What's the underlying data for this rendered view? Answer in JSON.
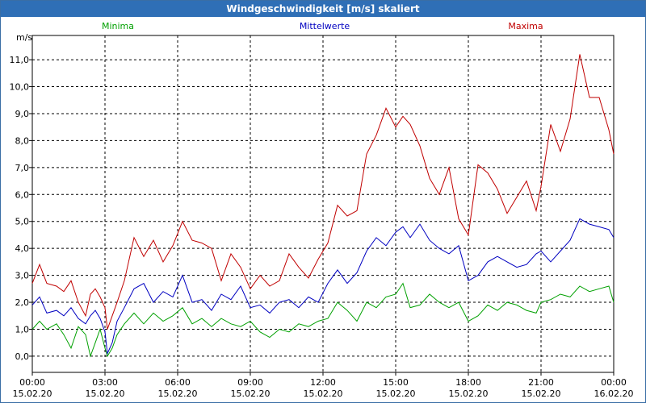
{
  "chart_data": {
    "type": "line",
    "title": "Windgeschwindigkeit [m/s] skaliert",
    "ylabel": "m/s",
    "xlabel": "",
    "ylim": [
      -0.6,
      11.9
    ],
    "xlim": [
      0,
      24
    ],
    "grid": true,
    "legend": "top",
    "y_ticks": [
      "0,0",
      "1,0",
      "2,0",
      "3,0",
      "4,0",
      "5,0",
      "6,0",
      "7,0",
      "8,0",
      "9,0",
      "10,0",
      "11,0"
    ],
    "x_ticks": [
      {
        "time": "00:00",
        "date": "15.02.20"
      },
      {
        "time": "03:00",
        "date": "15.02.20"
      },
      {
        "time": "06:00",
        "date": "15.02.20"
      },
      {
        "time": "09:00",
        "date": "15.02.20"
      },
      {
        "time": "12:00",
        "date": "15.02.20"
      },
      {
        "time": "15:00",
        "date": "15.02.20"
      },
      {
        "time": "18:00",
        "date": "15.02.20"
      },
      {
        "time": "21:00",
        "date": "15.02.20"
      },
      {
        "time": "00:00",
        "date": "16.02.20"
      }
    ],
    "series": [
      {
        "name": "Minima",
        "color": "#00a000",
        "points": [
          [
            0,
            1.0
          ],
          [
            0.3,
            1.3
          ],
          [
            0.6,
            1.0
          ],
          [
            1.0,
            1.2
          ],
          [
            1.3,
            0.8
          ],
          [
            1.6,
            0.3
          ],
          [
            1.9,
            1.1
          ],
          [
            2.2,
            0.8
          ],
          [
            2.4,
            0.0
          ],
          [
            2.6,
            0.5
          ],
          [
            2.8,
            1.0
          ],
          [
            3.0,
            0.3
          ],
          [
            3.1,
            0.0
          ],
          [
            3.3,
            0.3
          ],
          [
            3.5,
            0.8
          ],
          [
            3.8,
            1.2
          ],
          [
            4.2,
            1.6
          ],
          [
            4.6,
            1.2
          ],
          [
            5.0,
            1.6
          ],
          [
            5.4,
            1.3
          ],
          [
            5.8,
            1.5
          ],
          [
            6.2,
            1.8
          ],
          [
            6.6,
            1.2
          ],
          [
            7.0,
            1.4
          ],
          [
            7.4,
            1.1
          ],
          [
            7.8,
            1.4
          ],
          [
            8.2,
            1.2
          ],
          [
            8.6,
            1.1
          ],
          [
            9.0,
            1.3
          ],
          [
            9.4,
            0.9
          ],
          [
            9.8,
            0.7
          ],
          [
            10.2,
            1.0
          ],
          [
            10.6,
            0.9
          ],
          [
            11.0,
            1.2
          ],
          [
            11.4,
            1.1
          ],
          [
            11.8,
            1.3
          ],
          [
            12.2,
            1.4
          ],
          [
            12.6,
            2.0
          ],
          [
            13.0,
            1.7
          ],
          [
            13.4,
            1.3
          ],
          [
            13.8,
            2.0
          ],
          [
            14.2,
            1.8
          ],
          [
            14.6,
            2.2
          ],
          [
            15.0,
            2.3
          ],
          [
            15.3,
            2.7
          ],
          [
            15.6,
            1.8
          ],
          [
            16.0,
            1.9
          ],
          [
            16.4,
            2.3
          ],
          [
            16.8,
            2.0
          ],
          [
            17.2,
            1.8
          ],
          [
            17.6,
            2.0
          ],
          [
            18.0,
            1.3
          ],
          [
            18.4,
            1.5
          ],
          [
            18.8,
            1.9
          ],
          [
            19.2,
            1.7
          ],
          [
            19.6,
            2.0
          ],
          [
            20.0,
            1.9
          ],
          [
            20.4,
            1.7
          ],
          [
            20.8,
            1.6
          ],
          [
            21.0,
            2.0
          ],
          [
            21.4,
            2.1
          ],
          [
            21.8,
            2.3
          ],
          [
            22.2,
            2.2
          ],
          [
            22.6,
            2.6
          ],
          [
            23.0,
            2.4
          ],
          [
            23.4,
            2.5
          ],
          [
            23.8,
            2.6
          ],
          [
            24.0,
            2.0
          ]
        ]
      },
      {
        "name": "Mittelwerte",
        "color": "#0000c0",
        "points": [
          [
            0,
            1.9
          ],
          [
            0.3,
            2.2
          ],
          [
            0.6,
            1.6
          ],
          [
            1.0,
            1.7
          ],
          [
            1.3,
            1.5
          ],
          [
            1.6,
            1.8
          ],
          [
            1.9,
            1.4
          ],
          [
            2.2,
            1.2
          ],
          [
            2.4,
            1.5
          ],
          [
            2.6,
            1.7
          ],
          [
            2.8,
            1.4
          ],
          [
            3.0,
            0.9
          ],
          [
            3.1,
            0.1
          ],
          [
            3.3,
            0.5
          ],
          [
            3.5,
            1.3
          ],
          [
            3.8,
            1.8
          ],
          [
            4.2,
            2.5
          ],
          [
            4.6,
            2.7
          ],
          [
            5.0,
            2.0
          ],
          [
            5.4,
            2.4
          ],
          [
            5.8,
            2.2
          ],
          [
            6.2,
            3.0
          ],
          [
            6.6,
            2.0
          ],
          [
            7.0,
            2.1
          ],
          [
            7.4,
            1.7
          ],
          [
            7.8,
            2.3
          ],
          [
            8.2,
            2.1
          ],
          [
            8.6,
            2.6
          ],
          [
            9.0,
            1.8
          ],
          [
            9.4,
            1.9
          ],
          [
            9.8,
            1.6
          ],
          [
            10.2,
            2.0
          ],
          [
            10.6,
            2.1
          ],
          [
            11.0,
            1.8
          ],
          [
            11.4,
            2.2
          ],
          [
            11.8,
            2.0
          ],
          [
            12.2,
            2.7
          ],
          [
            12.6,
            3.2
          ],
          [
            13.0,
            2.7
          ],
          [
            13.4,
            3.1
          ],
          [
            13.8,
            3.9
          ],
          [
            14.2,
            4.4
          ],
          [
            14.6,
            4.1
          ],
          [
            15.0,
            4.6
          ],
          [
            15.3,
            4.8
          ],
          [
            15.6,
            4.4
          ],
          [
            16.0,
            4.9
          ],
          [
            16.4,
            4.3
          ],
          [
            16.8,
            4.0
          ],
          [
            17.2,
            3.8
          ],
          [
            17.6,
            4.1
          ],
          [
            18.0,
            2.8
          ],
          [
            18.4,
            3.0
          ],
          [
            18.8,
            3.5
          ],
          [
            19.2,
            3.7
          ],
          [
            19.6,
            3.5
          ],
          [
            20.0,
            3.3
          ],
          [
            20.4,
            3.4
          ],
          [
            20.8,
            3.8
          ],
          [
            21.0,
            3.9
          ],
          [
            21.4,
            3.5
          ],
          [
            21.8,
            3.9
          ],
          [
            22.2,
            4.3
          ],
          [
            22.6,
            5.1
          ],
          [
            23.0,
            4.9
          ],
          [
            23.4,
            4.8
          ],
          [
            23.8,
            4.7
          ],
          [
            24.0,
            4.4
          ]
        ]
      },
      {
        "name": "Maxima",
        "color": "#c00000",
        "points": [
          [
            0,
            2.7
          ],
          [
            0.3,
            3.4
          ],
          [
            0.6,
            2.7
          ],
          [
            1.0,
            2.6
          ],
          [
            1.3,
            2.4
          ],
          [
            1.6,
            2.8
          ],
          [
            1.9,
            2.0
          ],
          [
            2.2,
            1.5
          ],
          [
            2.4,
            2.3
          ],
          [
            2.6,
            2.5
          ],
          [
            2.8,
            2.2
          ],
          [
            3.0,
            1.8
          ],
          [
            3.1,
            1.0
          ],
          [
            3.3,
            1.5
          ],
          [
            3.5,
            2.0
          ],
          [
            3.8,
            2.8
          ],
          [
            4.2,
            4.4
          ],
          [
            4.6,
            3.7
          ],
          [
            5.0,
            4.3
          ],
          [
            5.4,
            3.5
          ],
          [
            5.8,
            4.1
          ],
          [
            6.2,
            5.0
          ],
          [
            6.6,
            4.3
          ],
          [
            7.0,
            4.2
          ],
          [
            7.4,
            4.0
          ],
          [
            7.8,
            2.8
          ],
          [
            8.2,
            3.8
          ],
          [
            8.6,
            3.3
          ],
          [
            9.0,
            2.5
          ],
          [
            9.4,
            3.0
          ],
          [
            9.8,
            2.6
          ],
          [
            10.2,
            2.8
          ],
          [
            10.6,
            3.8
          ],
          [
            11.0,
            3.3
          ],
          [
            11.4,
            2.9
          ],
          [
            11.8,
            3.6
          ],
          [
            12.2,
            4.2
          ],
          [
            12.6,
            5.6
          ],
          [
            13.0,
            5.2
          ],
          [
            13.4,
            5.4
          ],
          [
            13.8,
            7.5
          ],
          [
            14.2,
            8.2
          ],
          [
            14.6,
            9.2
          ],
          [
            15.0,
            8.5
          ],
          [
            15.3,
            8.9
          ],
          [
            15.6,
            8.6
          ],
          [
            16.0,
            7.8
          ],
          [
            16.4,
            6.6
          ],
          [
            16.8,
            6.0
          ],
          [
            17.2,
            7.0
          ],
          [
            17.6,
            5.1
          ],
          [
            18.0,
            4.5
          ],
          [
            18.4,
            7.1
          ],
          [
            18.8,
            6.8
          ],
          [
            19.2,
            6.2
          ],
          [
            19.6,
            5.3
          ],
          [
            20.0,
            5.9
          ],
          [
            20.4,
            6.5
          ],
          [
            20.8,
            5.4
          ],
          [
            21.0,
            6.3
          ],
          [
            21.4,
            8.6
          ],
          [
            21.8,
            7.6
          ],
          [
            22.2,
            8.8
          ],
          [
            22.6,
            11.2
          ],
          [
            23.0,
            9.6
          ],
          [
            23.4,
            9.6
          ],
          [
            23.8,
            8.4
          ],
          [
            24.0,
            7.5
          ]
        ]
      }
    ]
  }
}
